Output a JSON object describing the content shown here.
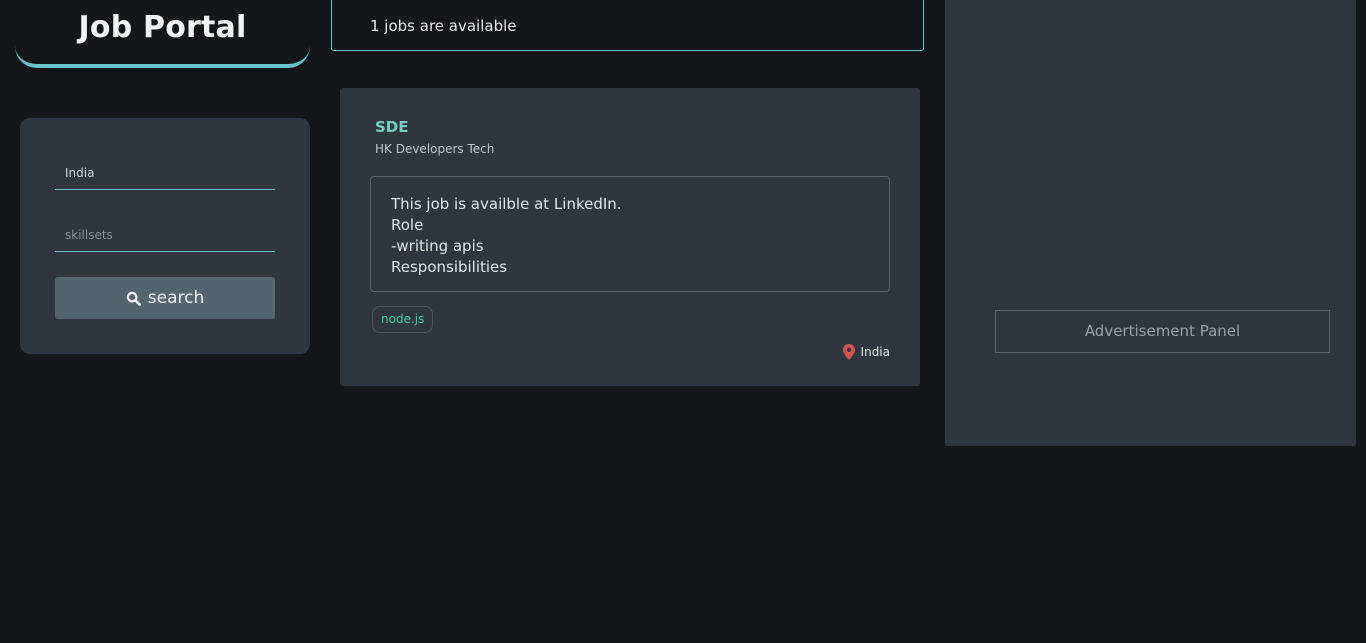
{
  "header": {
    "title": "Job Portal"
  },
  "search": {
    "location_value": "India",
    "skills_placeholder": "skillsets",
    "button_label": "search"
  },
  "results": {
    "availability_text": "1 jobs are available"
  },
  "jobs": [
    {
      "title": "SDE",
      "company": "HK Developers Tech",
      "description_lines": [
        "This job is availble at LinkedIn.",
        "Role",
        "-writing apis",
        "Responsibilities"
      ],
      "skills": [
        "node.js"
      ],
      "location": "India"
    }
  ],
  "ad": {
    "label": "Advertisement Panel"
  },
  "icons": {
    "search": "search-icon",
    "location": "map-pin-icon"
  },
  "colors": {
    "background": "#141619",
    "panel": "#2f363f",
    "accent": "#69c3cc",
    "job_title": "#78cfc5",
    "skill_tag": "#43d3a4",
    "pin": "#d9534f",
    "button": "#546572"
  }
}
